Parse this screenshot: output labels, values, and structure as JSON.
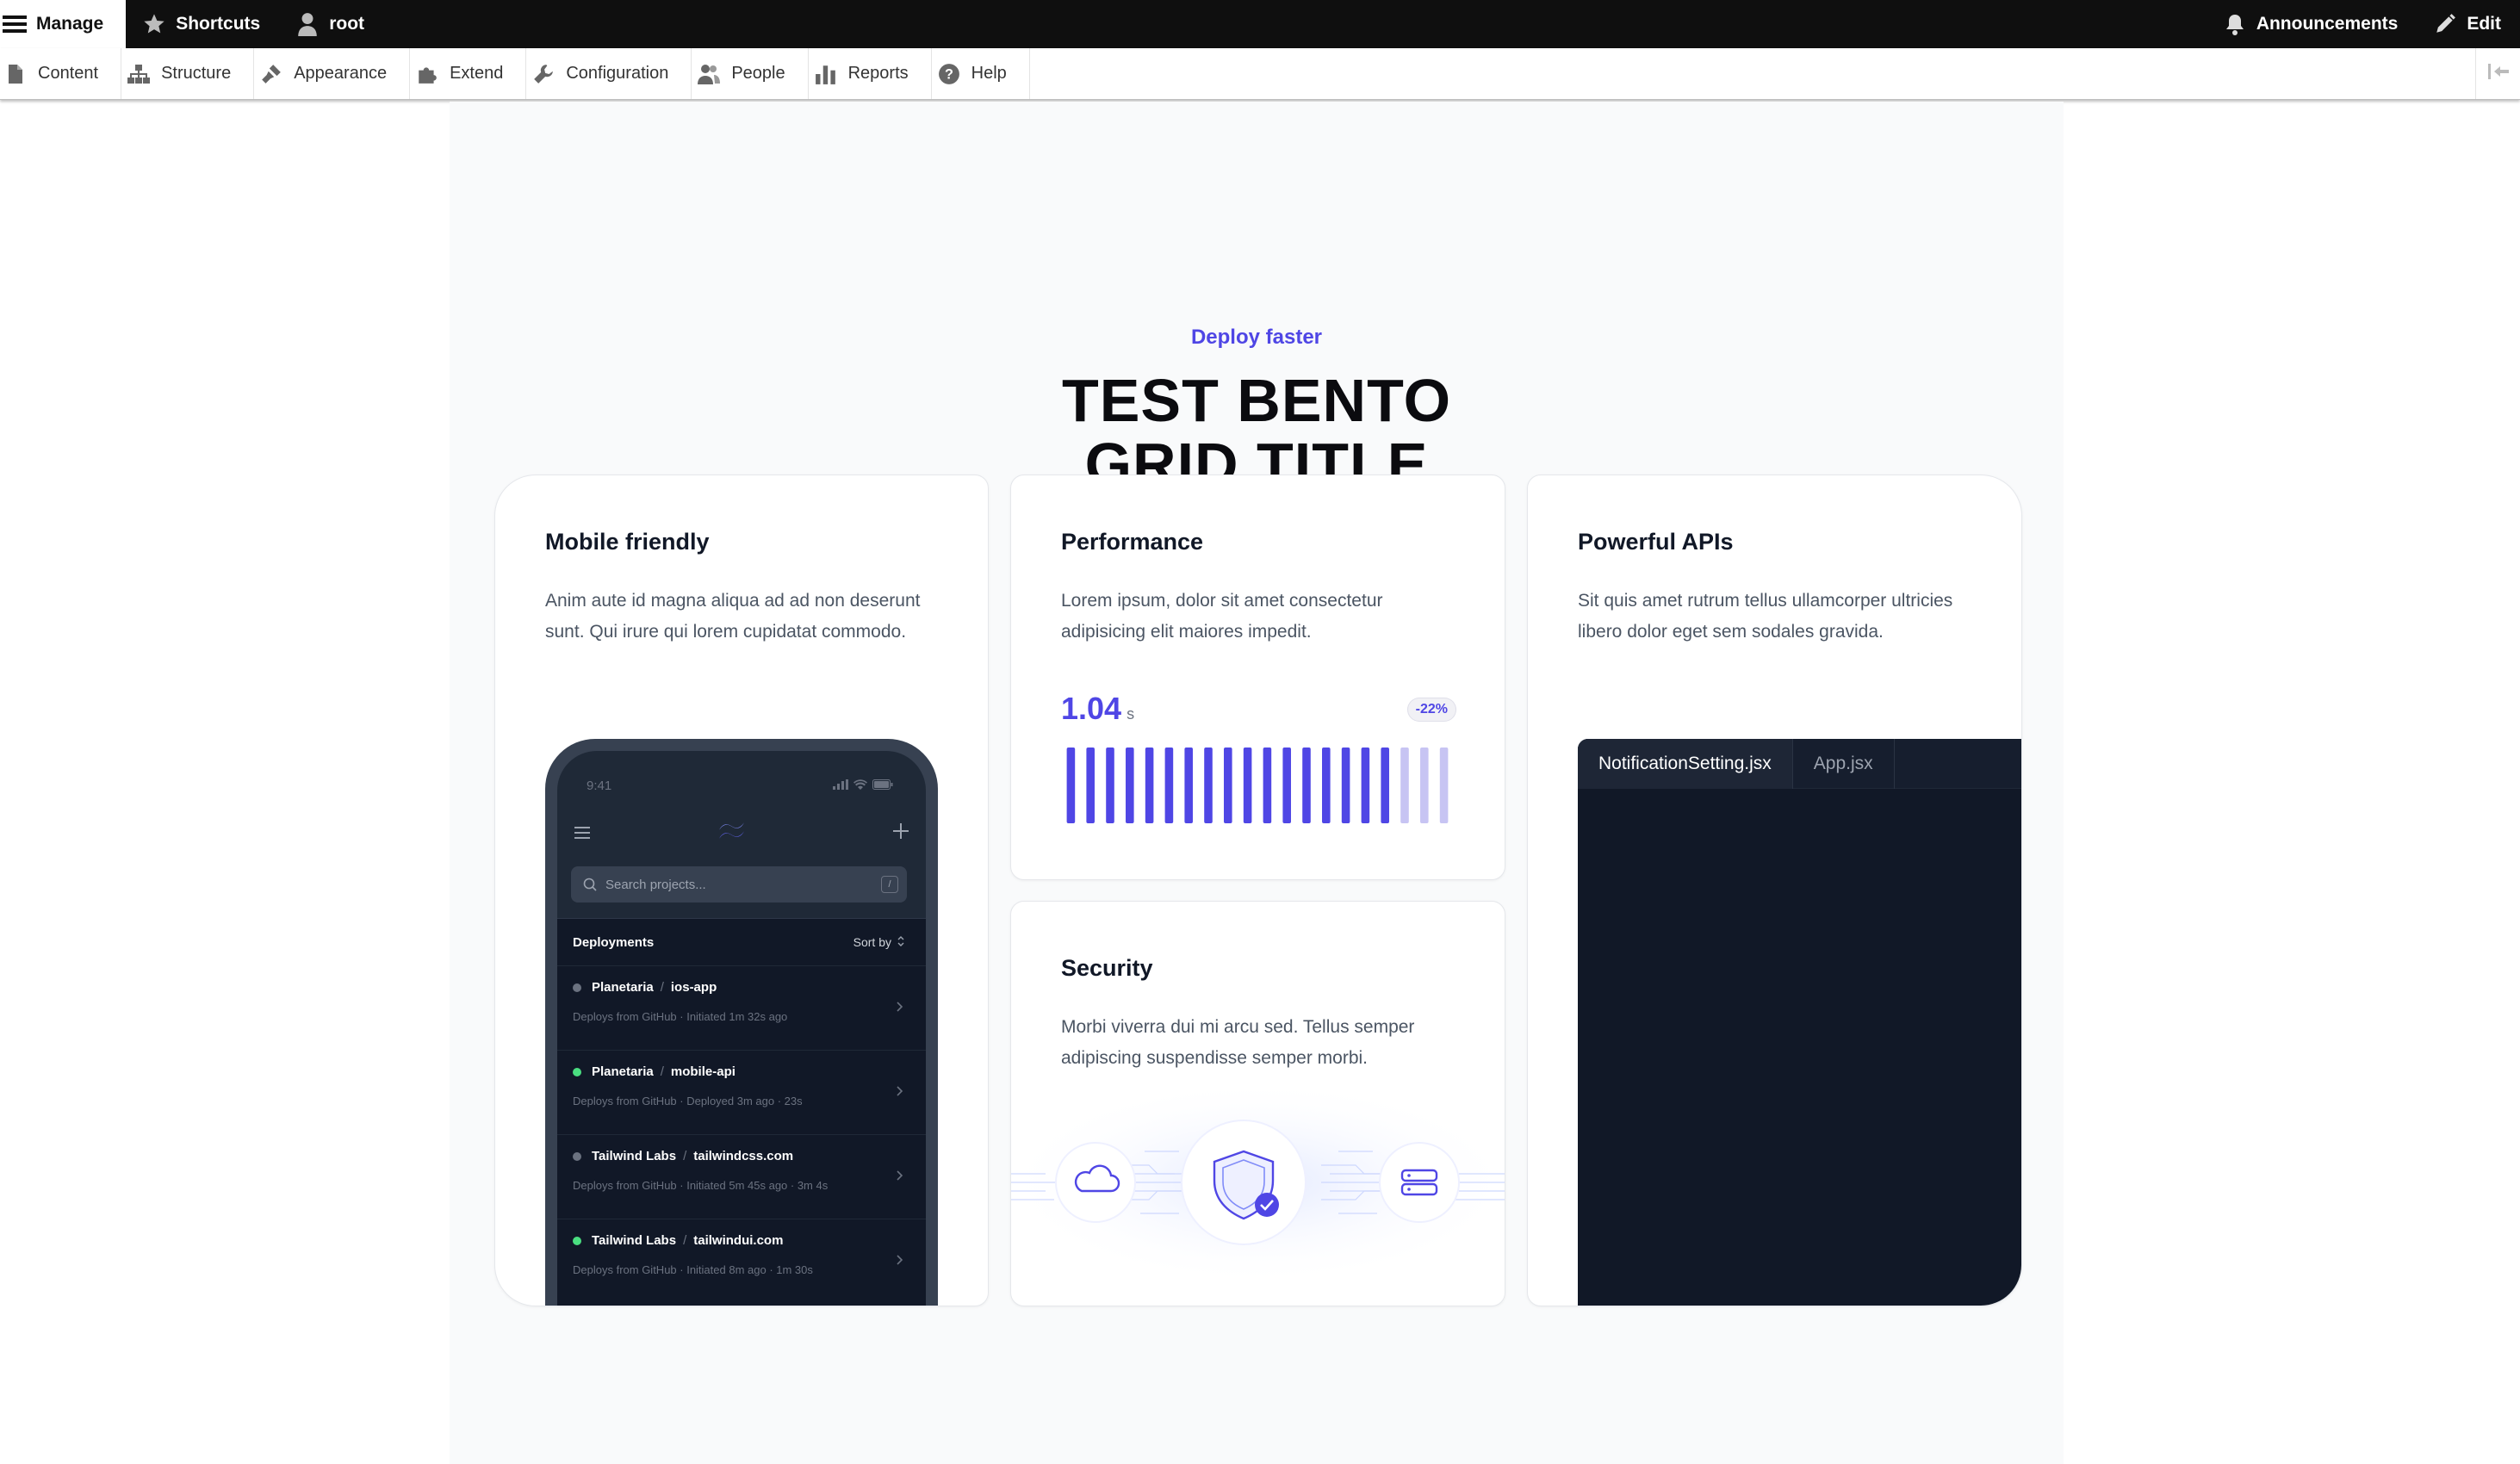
{
  "toolbar": {
    "manage": "Manage",
    "shortcuts": "Shortcuts",
    "user": "root",
    "announcements": "Announcements",
    "edit": "Edit"
  },
  "tray": [
    {
      "label": "Content",
      "icon": "file-icon"
    },
    {
      "label": "Structure",
      "icon": "sitemap-icon"
    },
    {
      "label": "Appearance",
      "icon": "paintbrush-icon"
    },
    {
      "label": "Extend",
      "icon": "puzzle-icon"
    },
    {
      "label": "Configuration",
      "icon": "wrench-icon"
    },
    {
      "label": "People",
      "icon": "people-icon"
    },
    {
      "label": "Reports",
      "icon": "bar-chart-icon"
    },
    {
      "label": "Help",
      "icon": "help-icon"
    }
  ],
  "hero": {
    "eyebrow": "Deploy faster",
    "title_line1": "TEST BENTO",
    "title_line2": "GRID TITLE"
  },
  "cards": {
    "mobile": {
      "title": "Mobile friendly",
      "text": "Anim aute id magna aliqua ad ad non deserunt sunt. Qui irure qui lorem cupidatat commodo."
    },
    "performance": {
      "title": "Performance",
      "text": "Lorem ipsum, dolor sit amet consectetur adipisicing elit maiores impedit.",
      "value": "1.04",
      "unit": "s",
      "badge": "-22%",
      "bars_total": 20,
      "bars_filled": 17
    },
    "security": {
      "title": "Security",
      "text": "Morbi viverra dui mi arcu sed. Tellus semper adipiscing suspendisse semper morbi."
    },
    "apis": {
      "title": "Powerful APIs",
      "text": "Sit quis amet rutrum tellus ullamcorper ultricies libero dolor eget sem sodales gravida.",
      "tabs": [
        "NotificationSetting.jsx",
        "App.jsx"
      ]
    }
  },
  "phone": {
    "time": "9:41",
    "search_placeholder": "Search projects...",
    "kbd": "/",
    "list_title": "Deployments",
    "sort_label": "Sort by",
    "rows": [
      {
        "org": "Planetaria",
        "project": "ios-app",
        "meta": "Deploys from GitHub  ·  Initiated 1m 32s ago",
        "status": "#6b7280"
      },
      {
        "org": "Planetaria",
        "project": "mobile-api",
        "meta": "Deploys from GitHub  ·  Deployed 3m ago  ·  23s",
        "status": "#4ade80"
      },
      {
        "org": "Tailwind Labs",
        "project": "tailwindcss.com",
        "meta": "Deploys from GitHub  ·  Initiated 5m 45s ago  ·  3m 4s",
        "status": "#6b7280"
      },
      {
        "org": "Tailwind Labs",
        "project": "tailwindui.com",
        "meta": "Deploys from GitHub  ·  Initiated 8m ago  ·  1m 30s",
        "status": "#4ade80"
      }
    ]
  },
  "colors": {
    "accent": "#4f46e5",
    "toolbar_bg": "#0f0f0f",
    "code_bg": "#111827"
  }
}
